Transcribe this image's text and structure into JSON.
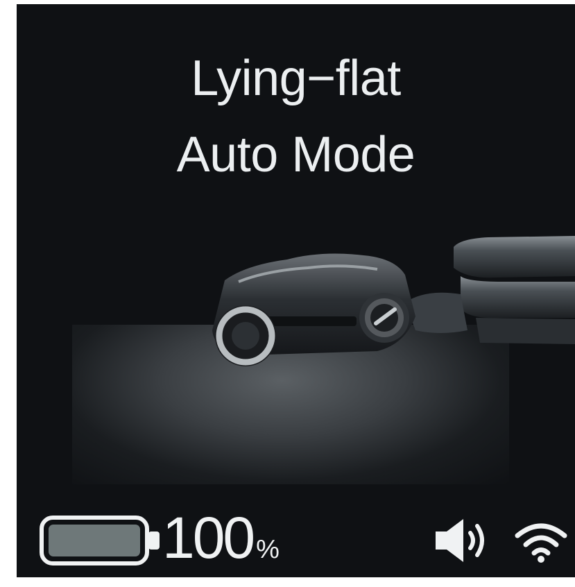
{
  "screen": {
    "title_line1": "Lying−flat",
    "title_line2": "Auto Mode"
  },
  "status": {
    "battery_value": "100",
    "battery_unit": "%",
    "battery_level": 1.0,
    "battery_icon": "battery-icon",
    "volume_icon": "speaker-volume-icon",
    "wifi_icon": "wifi-icon"
  },
  "colors": {
    "background": "#0f1114",
    "text": "#eceff1",
    "battery_fill": "#6e7879"
  }
}
